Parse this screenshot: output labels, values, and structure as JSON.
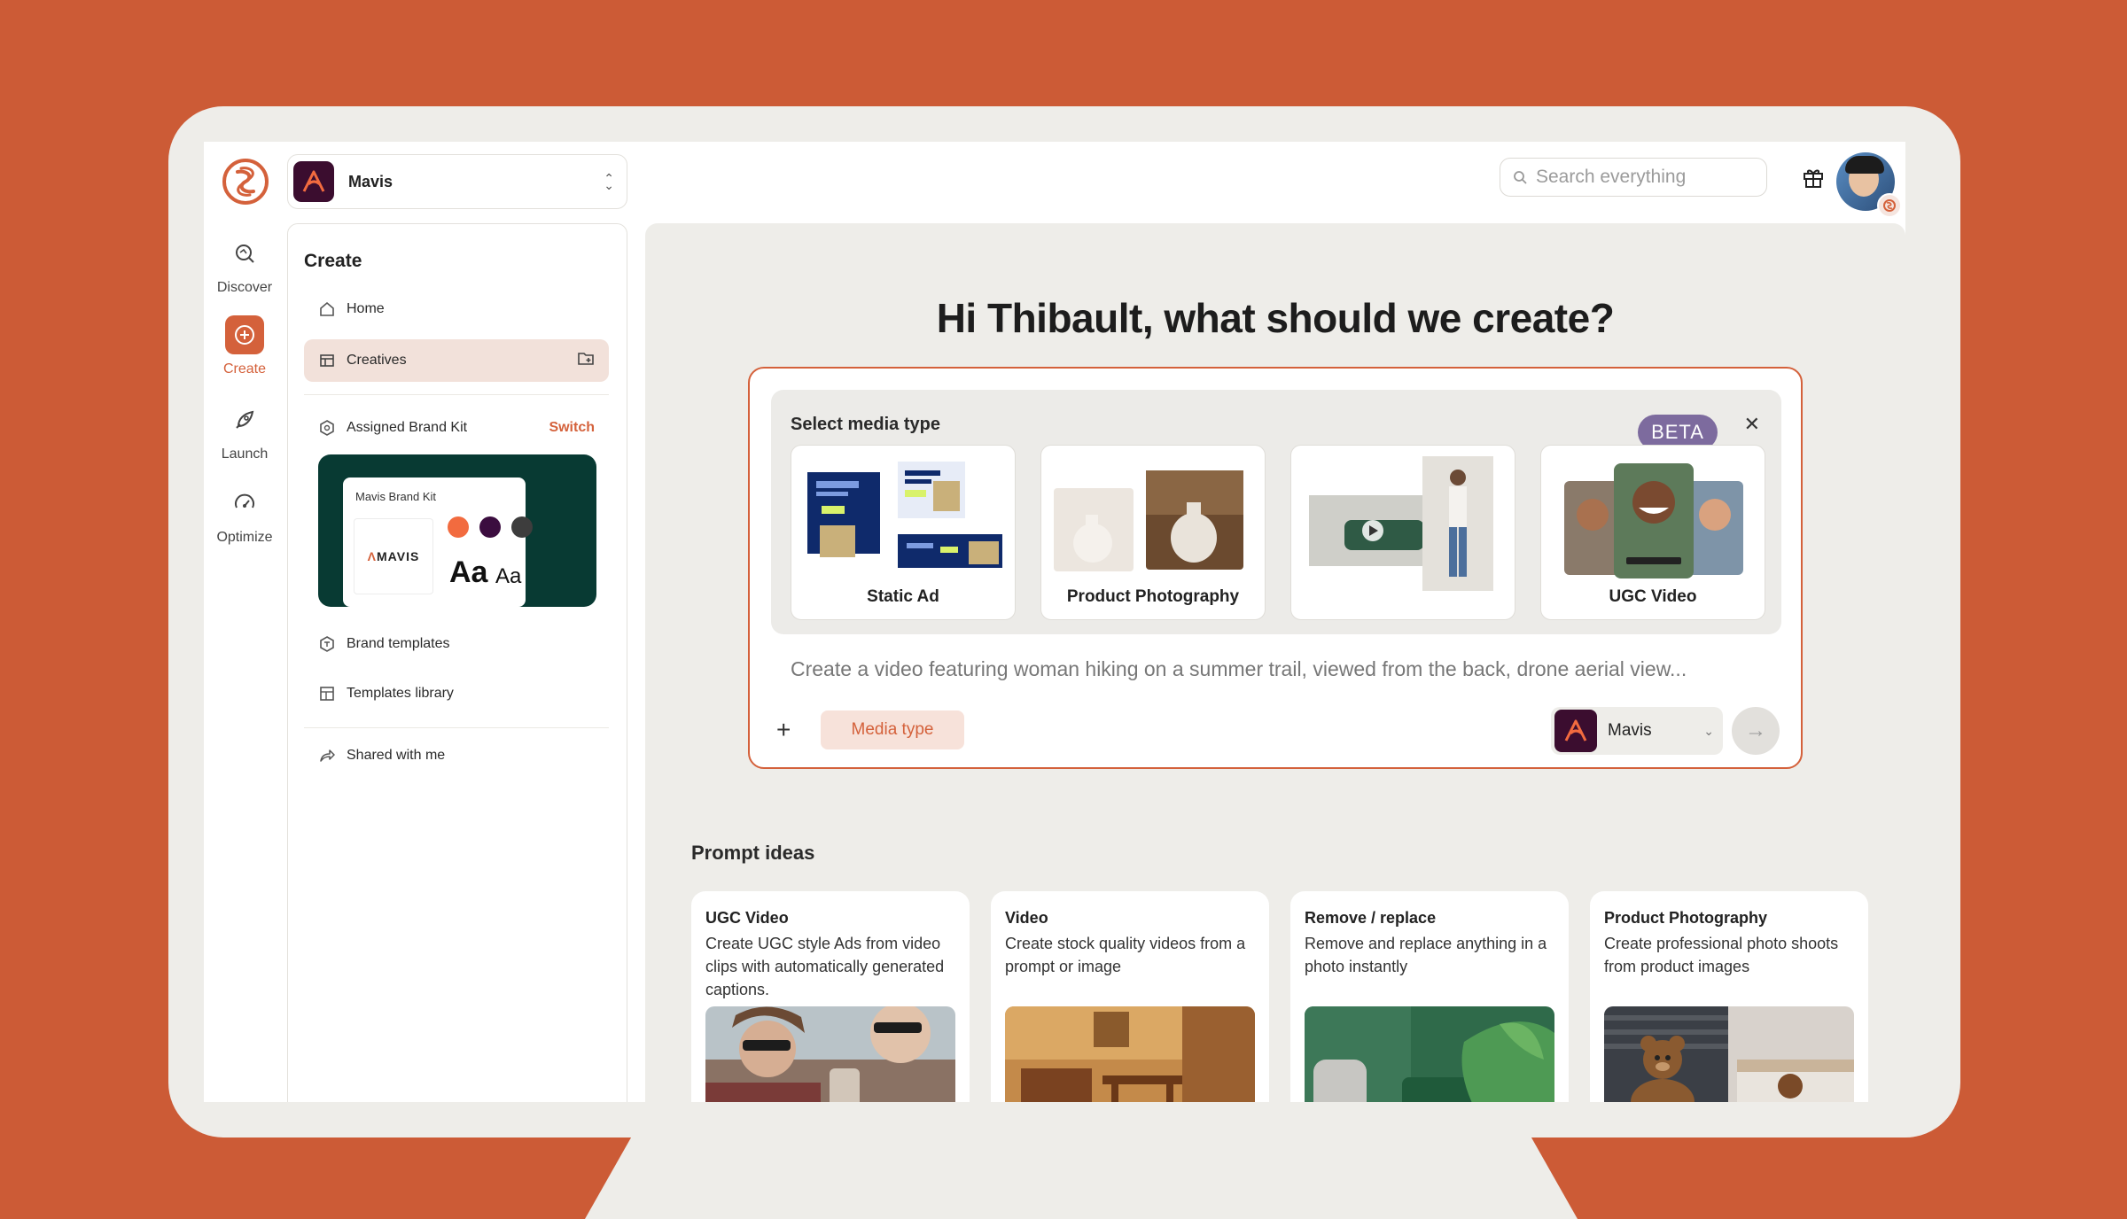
{
  "workspace": {
    "name": "Mavis"
  },
  "search": {
    "placeholder": "Search everything"
  },
  "rail": {
    "items": [
      {
        "label": "Discover"
      },
      {
        "label": "Create"
      },
      {
        "label": "Launch"
      },
      {
        "label": "Optimize"
      }
    ]
  },
  "sidebar": {
    "title": "Create",
    "home": "Home",
    "creatives": "Creatives",
    "assigned_brand_kit": "Assigned Brand Kit",
    "switch": "Switch",
    "brand_kit": {
      "title": "Mavis Brand Kit",
      "logo_text": "MAVIS",
      "font_large": "Aa",
      "font_small": "Aa",
      "colors": [
        "#f26b3f",
        "#3b0d3f",
        "#3d3d3d"
      ]
    },
    "brand_templates": "Brand templates",
    "templates_library": "Templates library",
    "shared_with_me": "Shared with me"
  },
  "main": {
    "greeting": "Hi Thibault, what should we create?",
    "media_panel": {
      "title": "Select media type",
      "beta": "BETA",
      "cards": [
        {
          "label": "Static Ad"
        },
        {
          "label": "Product Photography"
        },
        {
          "label": ""
        },
        {
          "label": "UGC Video"
        }
      ]
    },
    "prompt_placeholder": "Create a video featuring woman hiking on a summer trail, viewed from the back, drone aerial view...",
    "media_type_button": "Media type",
    "brand_select": "Mavis",
    "prompt_ideas": {
      "title": "Prompt ideas",
      "cards": [
        {
          "title": "UGC Video",
          "desc": "Create UGC style Ads from video clips with automatically generated captions."
        },
        {
          "title": "Video",
          "desc": "Create stock quality videos from a prompt or image"
        },
        {
          "title": "Remove / replace",
          "desc": "Remove and replace anything in a photo instantly"
        },
        {
          "title": "Product Photography",
          "desc": "Create professional photo shoots from product images"
        }
      ]
    }
  },
  "colors": {
    "background": "#cc5b36",
    "accent": "#d4613b",
    "device": "#eeede9",
    "brand_kit_bg": "#083a33"
  }
}
